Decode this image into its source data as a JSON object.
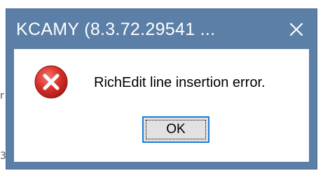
{
  "dialog": {
    "title": "KCAMY (8.3.72.29541 ...",
    "message": "RichEdit line insertion error.",
    "ok_label": "OK",
    "icon": "error-icon",
    "close_icon": "close-icon"
  },
  "background": {
    "mark_left_1": "r",
    "mark_left_2": "3"
  },
  "colors": {
    "titlebar": "#5b7fa6",
    "error_red": "#d9302a",
    "focus_border": "#1f7bd4"
  }
}
